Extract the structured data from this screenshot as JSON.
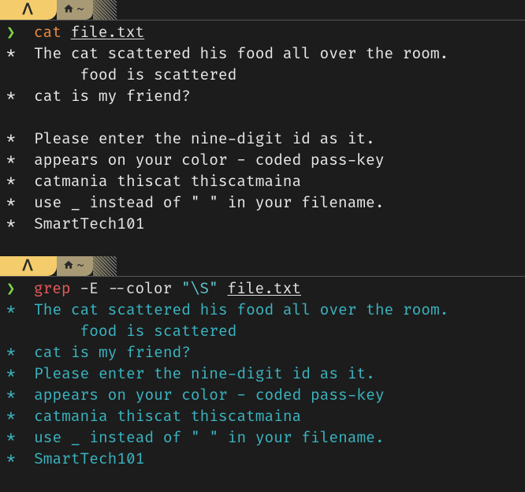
{
  "tab": {
    "glyph": "ᐱ",
    "home_icon": "home-icon",
    "path_sep": "~"
  },
  "prompt": {
    "symbol": "❯",
    "space": "  "
  },
  "cmd1": {
    "exe": "cat",
    "arg_file": "file.txt"
  },
  "out1": {
    "l1": "*  The cat scattered his food all over the room.",
    "l2": "        food is scattered",
    "l3": "*  cat is my friend?",
    "l4": "",
    "l5": "*  Please enter the nine-digit id as it.",
    "l6": "*  appears on your color - coded pass-key",
    "l7": "*  catmania thiscat thiscatmaina",
    "l8": "*  use _ instead of \" \" in your filename.",
    "l9": "*  SmartTech101"
  },
  "cmd2": {
    "exe": "grep",
    "flags": " -E --color ",
    "pattern": "\"\\S\"",
    "arg_file": "file.txt"
  },
  "out2": {
    "l1a": "*",
    "l1b": "  ",
    "l1c": "The",
    "l1d": " ",
    "l1e": "cat",
    "l1f": " ",
    "l1g": "scattered",
    "l1h": " ",
    "l1i": "his",
    "l1j": " ",
    "l1k": "food",
    "l1l": " ",
    "l1m": "all",
    "l1n": " ",
    "l1o": "over",
    "l1p": " ",
    "l1q": "the",
    "l1r": " ",
    "l1s": "room.",
    "l2a": "        ",
    "l2b": "food",
    "l2c": " ",
    "l2d": "is",
    "l2e": " ",
    "l2f": "scattered",
    "l3a": "*",
    "l3b": "  ",
    "l3c": "cat",
    "l3d": " ",
    "l3e": "is",
    "l3f": " ",
    "l3g": "my",
    "l3h": " ",
    "l3i": "friend?",
    "l5a": "*",
    "l5b": "  ",
    "l5c": "Please",
    "l5d": " ",
    "l5e": "enter",
    "l5f": " ",
    "l5g": "the",
    "l5h": " ",
    "l5i": "nine-digit",
    "l5j": " ",
    "l5k": "id",
    "l5l": " ",
    "l5m": "as",
    "l5n": " ",
    "l5o": "it.",
    "l6a": "*",
    "l6b": "  ",
    "l6c": "appears",
    "l6d": " ",
    "l6e": "on",
    "l6f": " ",
    "l6g": "your",
    "l6h": " ",
    "l6i": "color",
    "l6j": " ",
    "l6k": "-",
    "l6l": " ",
    "l6m": "coded",
    "l6n": " ",
    "l6o": "pass-key",
    "l7a": "*",
    "l7b": "  ",
    "l7c": "catmania",
    "l7d": " ",
    "l7e": "thiscat",
    "l7f": " ",
    "l7g": "thiscatmaina",
    "l8a": "*",
    "l8b": "  ",
    "l8c": "use",
    "l8d": " ",
    "l8e": "_",
    "l8f": " ",
    "l8g": "instead",
    "l8h": " ",
    "l8i": "of",
    "l8j": " ",
    "l8k": "\"",
    "l8l": " ",
    "l8m": "\"",
    "l8n": " ",
    "l8o": "in",
    "l8p": " ",
    "l8q": "your",
    "l8r": " ",
    "l8s": "filename.",
    "l9a": "*",
    "l9b": "  ",
    "l9c": "SmartTech101"
  }
}
